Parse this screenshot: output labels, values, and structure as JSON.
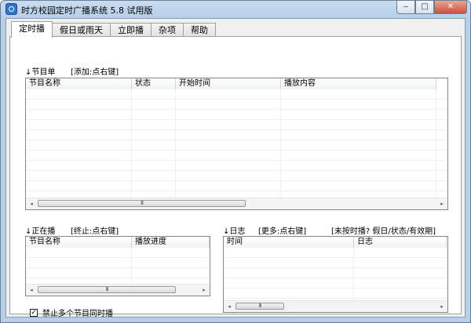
{
  "window": {
    "title": "时方校园定时广播系统 5.8 试用版",
    "minimize": "‒",
    "maximize": "□",
    "close": "✕"
  },
  "tabs": [
    {
      "label": "定时播",
      "active": true
    },
    {
      "label": "假日或雨天"
    },
    {
      "label": "立即播"
    },
    {
      "label": "杂项"
    },
    {
      "label": "帮助"
    }
  ],
  "schedule": {
    "heading": "↓节目单",
    "hint": "[添加:点右键]",
    "columns": [
      "节目名称",
      "状态",
      "开始时间",
      "播放内容"
    ],
    "scroll_thumb": "III"
  },
  "playing": {
    "heading": "↓正在播",
    "hint": "[终止:点右键]",
    "columns": [
      "节目名称",
      "播放进度"
    ],
    "scroll_thumb": "III"
  },
  "log": {
    "heading": "↓日志",
    "hint": "[更多:点右键]",
    "hint2": "[未按时播? 假日/状态/有效期]",
    "columns": [
      "时间",
      "日志"
    ],
    "scroll_thumb": "III"
  },
  "options": {
    "no_overlap_label": "禁止多个节目同时播",
    "no_overlap_checked": true,
    "check_mark": "✓"
  },
  "icons": {
    "scroll_left": "◂",
    "scroll_right": "▸"
  }
}
